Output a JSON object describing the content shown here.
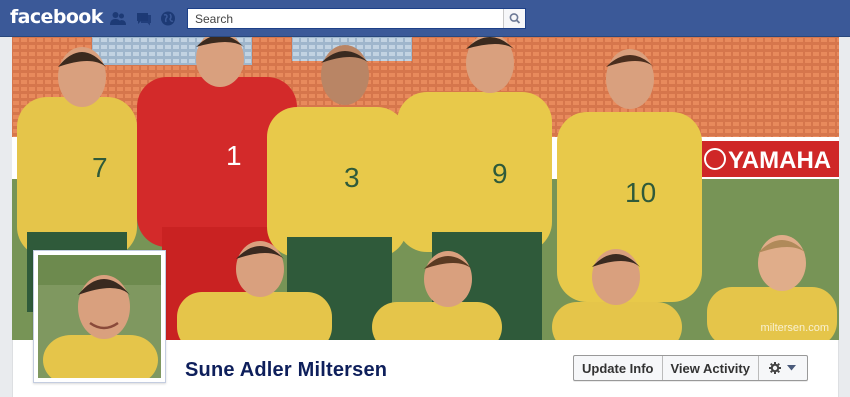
{
  "header": {
    "logo": "facebook",
    "search": {
      "placeholder": "Search"
    }
  },
  "cover": {
    "watermark": "miltersen.com",
    "banner_text": "YAMAHA",
    "jersey_numbers": [
      "7",
      "1",
      "3",
      "9",
      "10"
    ]
  },
  "profile": {
    "name": "Sune Adler Miltersen"
  },
  "actions": {
    "update_info": "Update Info",
    "view_activity": "View Activity"
  },
  "colors": {
    "brand": "#3b5998",
    "name": "#0e1f5b",
    "jersey_yellow": "#e8c94a",
    "keeper_red": "#d32a2a",
    "shorts_green": "#2f5a3a"
  }
}
